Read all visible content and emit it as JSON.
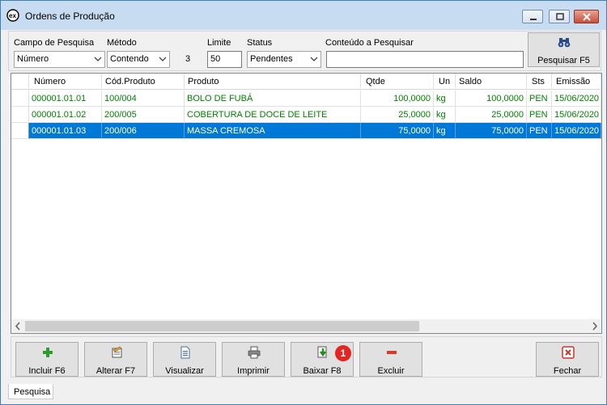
{
  "window": {
    "title": "Ordens de Produção"
  },
  "search": {
    "field_label": "Campo de Pesquisa",
    "field_value": "Número",
    "method_label": "Método",
    "method_value": "Contendo",
    "method_count": "3",
    "limit_label": "Limite",
    "limit_value": "50",
    "status_label": "Status",
    "status_value": "Pendentes",
    "content_label": "Conteúdo a Pesquisar",
    "content_value": "",
    "search_button": "Pesquisar F5"
  },
  "grid": {
    "columns": [
      "Número",
      "Cód.Produto",
      "Produto",
      "Qtde",
      "Un",
      "Saldo",
      "Sts",
      "Emissão"
    ],
    "rows": [
      [
        "000001.01.01",
        "100/004",
        "BOLO DE FUBÁ",
        "100,0000",
        "kg",
        "100,0000",
        "PEN",
        "15/06/2020"
      ],
      [
        "000001.01.02",
        "200/005",
        "COBERTURA DE DOCE DE LEITE",
        "25,0000",
        "kg",
        "25,0000",
        "PEN",
        "15/06/2020"
      ],
      [
        "000001.01.03",
        "200/006",
        "MASSA CREMOSA",
        "75,0000",
        "kg",
        "75,0000",
        "PEN",
        "15/06/2020"
      ]
    ],
    "selected_row": 2
  },
  "toolbar": {
    "include": "Incluir F6",
    "alter": "Alterar F7",
    "view": "Visualizar",
    "print": "Imprimir",
    "lower": "Baixar F8",
    "delete": "Excluir",
    "close": "Fechar",
    "badge": "1"
  },
  "tabs": {
    "search_tab": "Pesquisa"
  },
  "colors": {
    "row_text": "#008000",
    "selection": "#0078d7",
    "badge": "#e42521"
  }
}
